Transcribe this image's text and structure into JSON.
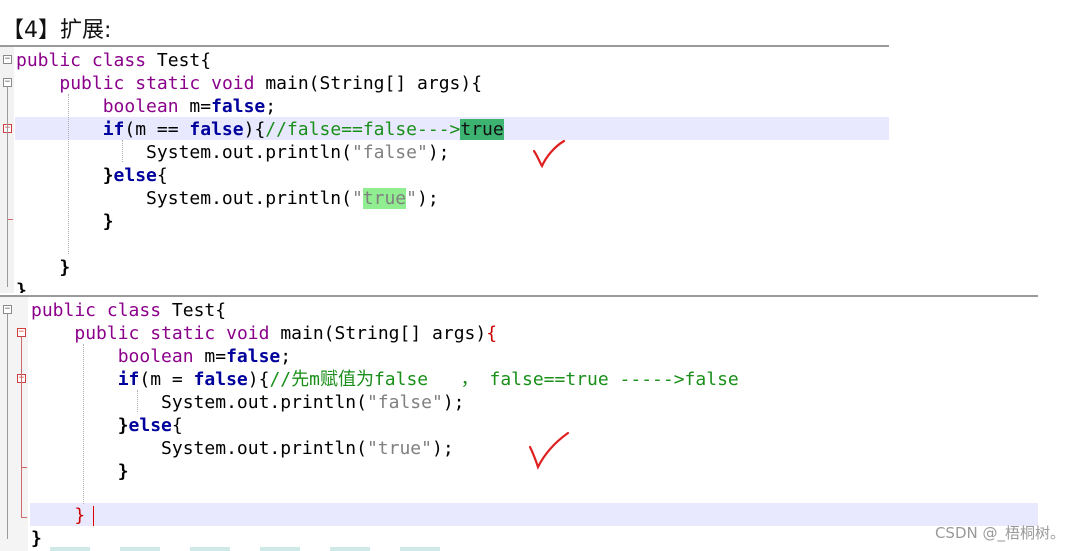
{
  "heading": "【4】扩展:",
  "editor1": {
    "lines": {
      "l1_a": "public",
      "l1_b": "class",
      "l1_c": "Test{",
      "l2_a": "public",
      "l2_b": "static",
      "l2_c": "void",
      "l2_d": "main(String[] args){",
      "l3_a": "boolean",
      "l3_b": " m=",
      "l3_c": "false",
      "l3_d": ";",
      "l4_a": "if",
      "l4_b": "(m == ",
      "l4_c": "false",
      "l4_d": "){",
      "l4_e": "//false==false--->",
      "l4_f": "true",
      "l5_a": "System.out.println(",
      "l5_b": "\"false\"",
      "l5_c": ");",
      "l6_a": "}",
      "l6_b": "else",
      "l6_c": "{",
      "l7_a": "System.out.println(",
      "l7_b": "\"",
      "l7_c": "true",
      "l7_d": "\"",
      "l7_e": ");",
      "l8": "}",
      "l10": "}",
      "l11": "}"
    }
  },
  "editor2": {
    "lines": {
      "l1_a": "public",
      "l1_b": "class",
      "l1_c": "Test{",
      "l2_a": "public",
      "l2_b": "static",
      "l2_c": "void",
      "l2_d": "main(String[] args)",
      "l2_e": "{",
      "l3_a": "boolean",
      "l3_b": " m=",
      "l3_c": "false",
      "l3_d": ";",
      "l4_a": "if",
      "l4_b": "(m = ",
      "l4_c": "false",
      "l4_d": "){",
      "l4_e": "//先m赋值为false   ， false==true ----->false",
      "l5_a": "System.out.println(",
      "l5_b": "\"false\"",
      "l5_c": ");",
      "l6_a": "}",
      "l6_b": "else",
      "l6_c": "{",
      "l7_a": "System.out.println(",
      "l7_b": "\"true\"",
      "l7_c": ");",
      "l8": "}",
      "l10": "}",
      "l11": "}"
    }
  },
  "watermark": "CSDN @_梧桐树。",
  "colors": {
    "keyword": "#8b008b",
    "bold_keyword": "#00009c",
    "comment": "#1a8f1a",
    "string": "#808080",
    "line_highlight": "#e8e8ff",
    "match_highlight": "#3cb371",
    "checkmark": "#e02020"
  }
}
